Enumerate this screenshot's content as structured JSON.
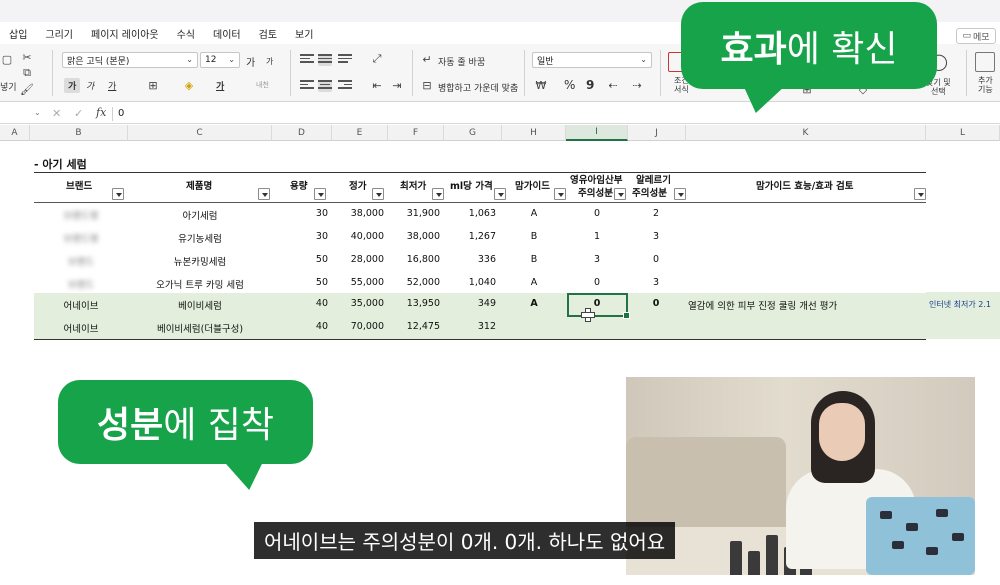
{
  "menu": [
    "삽입",
    "그리기",
    "페이지 레이아웃",
    "수식",
    "데이터",
    "검토",
    "보기"
  ],
  "memo_button": "메모",
  "ribbon": {
    "paste_partial": "넣기",
    "font_name": "맑은 고딕 (본문)",
    "font_size": "12",
    "grow_font": "가",
    "shrink_font": "가",
    "bold": "가",
    "italic": "가",
    "underline": "가",
    "font_color_glyph": "가",
    "phonetic": "내천",
    "wrap_text": "자동 줄 바꿈",
    "merge_center": "병합하고 가운데 맞춤",
    "number_format": "일반",
    "percent": "%",
    "comma": "9",
    "cond_format_partial": "조건\n서식",
    "find_select": "찾기 및\n선택",
    "addins": "추가\n기능"
  },
  "formula_bar": {
    "fx": "fx",
    "cancel": "✕",
    "enter": "✓",
    "value": "0"
  },
  "columns": [
    "A",
    "B",
    "C",
    "D",
    "E",
    "F",
    "G",
    "H",
    "I",
    "J",
    "K",
    "L"
  ],
  "active_column": "I",
  "sheet": {
    "section_title": "- 아기 세럼",
    "headers": {
      "brand": "브랜드",
      "product": "제품명",
      "volume": "용량",
      "price": "정가",
      "lowest": "최저가",
      "per_ml": "ml당 가격",
      "hwahae": "맘가이드",
      "caution_line1": "영유아임산부",
      "caution_line2": "주의성분",
      "allergy_line1": "알레르기",
      "allergy_line2": "주의성분",
      "review": "맘가이드 효능/효과 검토"
    },
    "rows": [
      {
        "brand": "브랜드명",
        "product": "아기세럼",
        "volume": "30",
        "price": "38,000",
        "lowest": "31,900",
        "per_ml": "1,063",
        "grade": "A",
        "caution": "0",
        "allergy": "2",
        "review": "",
        "blurred": true,
        "highlight": false
      },
      {
        "brand": "브랜드명",
        "product": "유기농세럼",
        "volume": "30",
        "price": "40,000",
        "lowest": "38,000",
        "per_ml": "1,267",
        "grade": "B",
        "caution": "1",
        "allergy": "3",
        "review": "",
        "blurred": true,
        "highlight": false
      },
      {
        "brand": "브랜드",
        "product": "뉴본카밍세럼",
        "volume": "50",
        "price": "28,000",
        "lowest": "16,800",
        "per_ml": "336",
        "grade": "B",
        "caution": "3",
        "allergy": "0",
        "review": "",
        "blurred": true,
        "highlight": false
      },
      {
        "brand": "브랜드",
        "product": "오가닉 트루 카밍 세럼",
        "volume": "50",
        "price": "55,000",
        "lowest": "52,000",
        "per_ml": "1,040",
        "grade": "A",
        "caution": "0",
        "allergy": "3",
        "review": "",
        "blurred": true,
        "highlight": false
      },
      {
        "brand": "어네이브",
        "product": "베이비세럼",
        "volume": "40",
        "price": "35,000",
        "lowest": "13,950",
        "per_ml": "349",
        "grade": "A",
        "caution": "0",
        "allergy": "0",
        "review": "열감에 의한 피부 진정 쿨링 개선 평가",
        "blurred": false,
        "highlight": true
      },
      {
        "brand": "어네이브",
        "product": "베이비세럼(더블구성)",
        "volume": "40",
        "price": "70,000",
        "lowest": "12,475",
        "per_ml": "312",
        "grade": "",
        "caution": "",
        "allergy": "",
        "review": "",
        "blurred": false,
        "highlight": true
      }
    ],
    "side_note": "인터넷 최저가 2.1"
  },
  "bubbles": {
    "top_strong": "효과",
    "top_rest": "에 확신",
    "left_strong": "성분",
    "left_rest": "에 집착"
  },
  "subtitle": "어네이브는 주의성분이 0개. 0개. 하나도 없어요",
  "colors": {
    "accent_green": "#16a34a",
    "excel_green": "#217346",
    "row_highlight": "#e3efdc"
  }
}
